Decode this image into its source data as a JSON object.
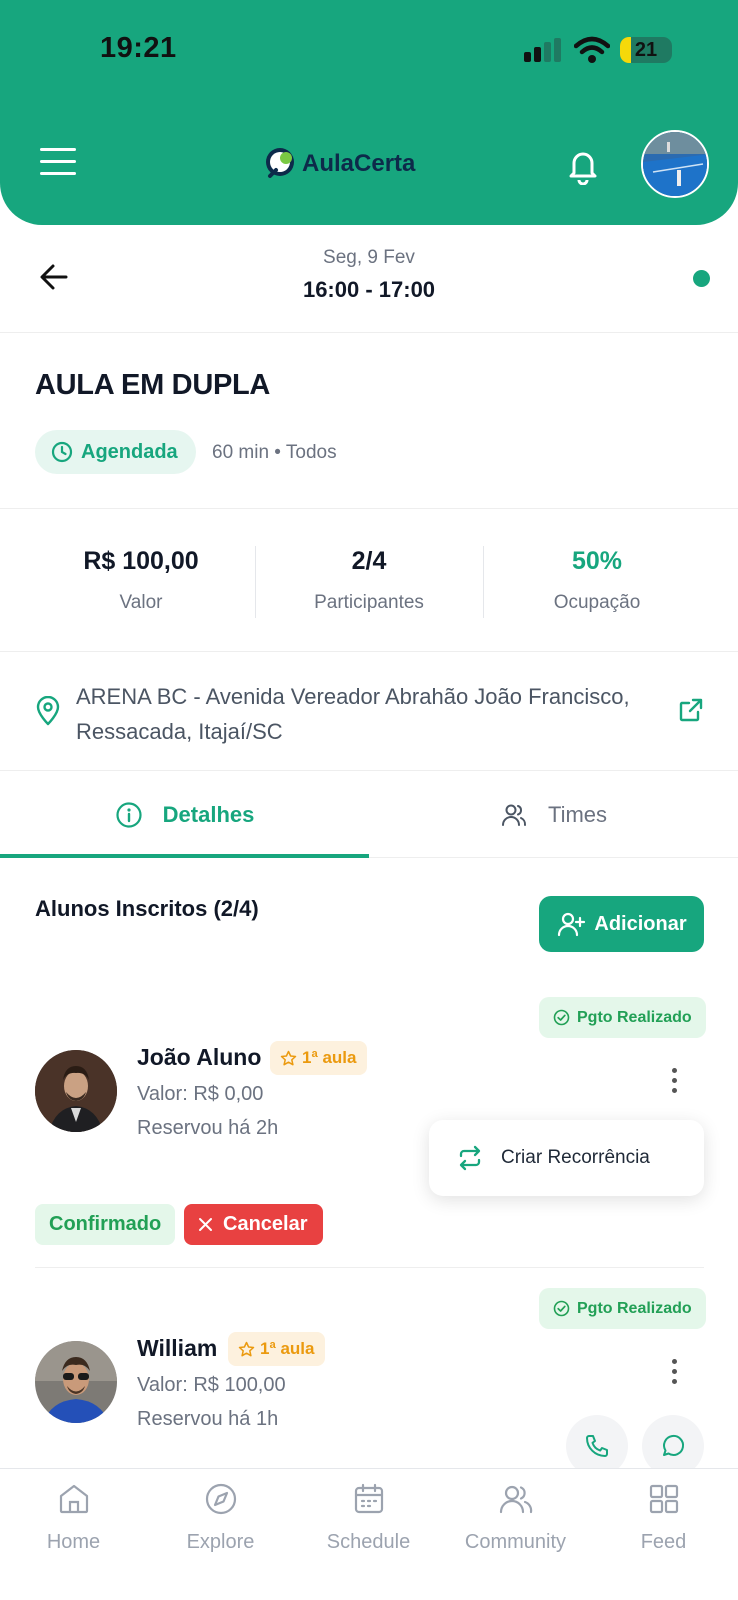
{
  "status_bar": {
    "time": "19:21",
    "battery": "21",
    "battery_level": 0.21
  },
  "header": {
    "logo_primary": "Aula",
    "logo_accent": "Certa",
    "icons": [
      "menu-icon",
      "bell-icon"
    ]
  },
  "datebar": {
    "date": "Seg, 9 Fev",
    "time_range": "16:00 - 17:00"
  },
  "class_info": {
    "title": "AULA EM DUPLA",
    "status": "Agendada",
    "meta": "60 min • Todos"
  },
  "stats": [
    {
      "value": "R$ 100,00",
      "label": "Valor"
    },
    {
      "value": "2/4",
      "label": "Participantes"
    },
    {
      "value": "50%",
      "label": "Ocupação"
    }
  ],
  "location": {
    "address": "ARENA BC - Avenida Vereador Abrahão João Francisco, Ressacada, Itajaí/SC"
  },
  "tabs": [
    {
      "label": "Detalhes",
      "icon": "info-icon",
      "active": true
    },
    {
      "label": "Times",
      "icon": "users-icon",
      "active": false
    }
  ],
  "enrolled": {
    "title": "Alunos Inscritos (2/4)",
    "add_label": "Adicionar",
    "students": [
      {
        "name": "João Aluno",
        "badge": "1ª aula",
        "payment": "Pgto Realizado",
        "value": "Valor: R$ 0,00",
        "reserved": "Reservou há 2h",
        "status": "Confirmado",
        "cancel_label": "Cancelar"
      },
      {
        "name": "William",
        "badge": "1ª aula",
        "payment": "Pgto Realizado",
        "value": "Valor: R$ 100,00",
        "reserved": "Reservou há 1h"
      }
    ],
    "menu_item": "Criar Recorrência"
  },
  "bottom_nav": [
    {
      "label": "Home",
      "icon": "home-icon"
    },
    {
      "label": "Explore",
      "icon": "compass-icon"
    },
    {
      "label": "Schedule",
      "icon": "calendar-icon"
    },
    {
      "label": "Community",
      "icon": "users-icon"
    },
    {
      "label": "Feed",
      "icon": "grid-icon"
    }
  ],
  "colors": {
    "brand": "#17a67e",
    "danger": "#e84141",
    "success": "#22a056",
    "warning": "#eb9a0f"
  }
}
